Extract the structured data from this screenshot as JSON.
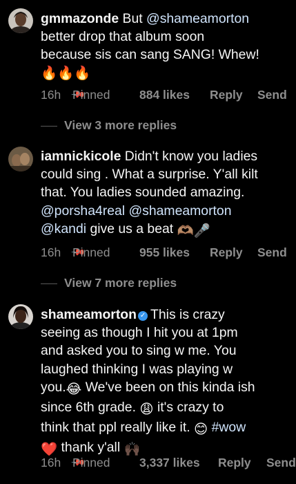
{
  "comments": [
    {
      "username": "gmmazonde",
      "lines": {
        "l1": "But",
        "l1_mention": "@shameamorton",
        "l2": "better drop that album soon",
        "l3": "because sis can sang SANG! Whew!",
        "l4_emoji": "🔥🔥🔥"
      },
      "time": "16h",
      "pinned": "Pinned",
      "likes": "884 likes",
      "reply": "Reply",
      "send": "Send",
      "view_more": "View 3 more replies"
    },
    {
      "username": "iamnickicole",
      "lines": {
        "l1": "Didn't know you ladies",
        "l2": "could sing . What a surprise. Y'all kilt",
        "l3": "that. You ladies sounded amazing.",
        "l4_mention_a": "@porsha4real",
        "l4_mention_b": "@shameamorton",
        "l5_mention": "@kandi",
        "l5": "give us a beat"
      },
      "time": "16h",
      "pinned": "Pinned",
      "likes": "955 likes",
      "reply": "Reply",
      "send": "Send",
      "view_more": "View 7 more replies"
    },
    {
      "username": "shameamorton",
      "verified": true,
      "lines": {
        "l1": "This is crazy",
        "l2": "seeing as though I hit you at 1pm",
        "l3": "and asked you to sing w me. You",
        "l4": "laughed thinking I was playing w",
        "l5": "you.",
        "l5b": "We've been on this kinda ish",
        "l6": "since 6th grade.",
        "l6b": "it's crazy to",
        "l7": "think that ppl really like it.",
        "l7_hashtag": "#wow",
        "l8": "thank y'all"
      },
      "time": "16h",
      "pinned": "Pinned",
      "likes": "3,337 likes",
      "reply": "Reply",
      "send": "Send"
    }
  ],
  "colors": {
    "background": "#000000",
    "text": "#f5f5f5",
    "meta": "#8e8e8e",
    "mention": "#cfe3fb",
    "verified": "#3897f0"
  },
  "icons": {
    "pin": "pin-icon",
    "verified": "verified-badge-icon"
  }
}
